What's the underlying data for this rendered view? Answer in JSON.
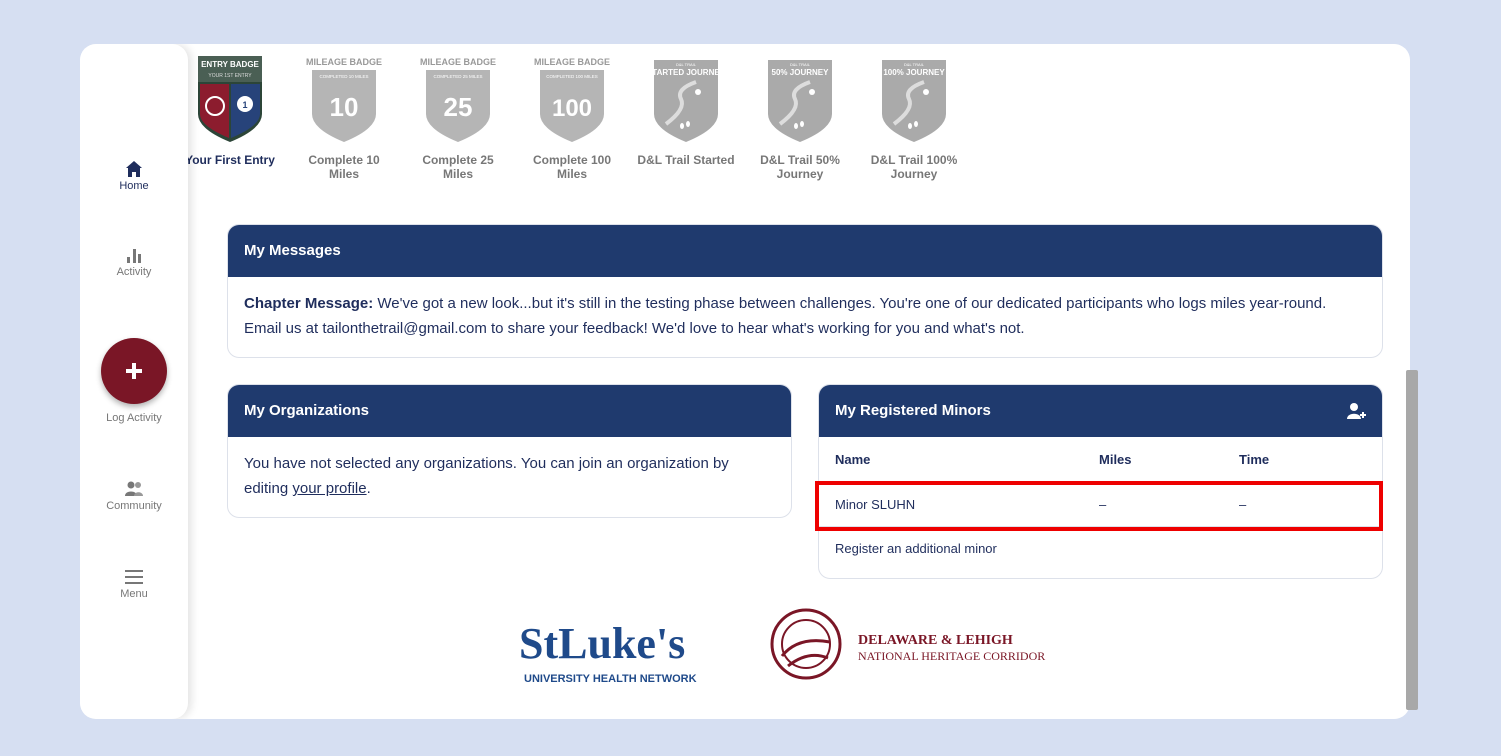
{
  "nav": {
    "home": "Home",
    "activity": "Activity",
    "log_activity": "Log Activity",
    "community": "Community",
    "menu": "Menu"
  },
  "badges": [
    {
      "top_text": "ENTRY BADGE",
      "sub_text": "YOUR 1ST ENTRY",
      "label": "Your First Entry",
      "earned": true
    },
    {
      "top_text": "MILEAGE BADGE",
      "sub_text": "COMPLETED 10 MILES",
      "number": "10",
      "label": "Complete 10 Miles",
      "earned": false
    },
    {
      "top_text": "MILEAGE BADGE",
      "sub_text": "COMPLETED 25 MILES",
      "number": "25",
      "label": "Complete 25 Miles",
      "earned": false
    },
    {
      "top_text": "MILEAGE BADGE",
      "sub_text": "COMPLETED 100 MILES",
      "number": "100",
      "label": "Complete 100 Miles",
      "earned": false
    },
    {
      "top_text": "STARTED JOURNEY",
      "sub_text": "D&L TRAIL",
      "label": "D&L Trail Started",
      "earned": false
    },
    {
      "top_text": "50% JOURNEY",
      "sub_text": "D&L TRAIL",
      "label": "D&L Trail 50% Journey",
      "earned": false
    },
    {
      "top_text": "100% JOURNEY",
      "sub_text": "D&L TRAIL",
      "label": "D&L Trail 100% Journey",
      "earned": false
    }
  ],
  "messages": {
    "title": "My Messages",
    "prefix": "Chapter Message:",
    "text": " We've got a new look...but it's still in the testing phase between challenges. You're one of our dedicated participants who logs miles year-round. Email us at tailonthetrail@gmail.com to share your feedback! We'd love to hear what's working for you and what's not."
  },
  "organizations": {
    "title": "My Organizations",
    "text_before": "You have not selected any organizations. You can join an organization by editing ",
    "link": "your profile",
    "text_after": "."
  },
  "minors": {
    "title": "My Registered Minors",
    "columns": [
      "Name",
      "Miles",
      "Time"
    ],
    "rows": [
      {
        "name": "Minor SLUHN",
        "miles": "–",
        "time": "–"
      }
    ],
    "register_link": "Register an additional minor"
  },
  "logos": {
    "stlukes_name": "StLuke's",
    "stlukes_sub": "UNIVERSITY HEALTH NETWORK",
    "dl_line1": "DELAWARE & LEHIGH",
    "dl_line2": "NATIONAL HERITAGE CORRIDOR"
  },
  "colors": {
    "navy": "#1f3a6e",
    "maroon": "#7a1626",
    "background": "#d6dff2",
    "highlight": "#ee0000"
  }
}
